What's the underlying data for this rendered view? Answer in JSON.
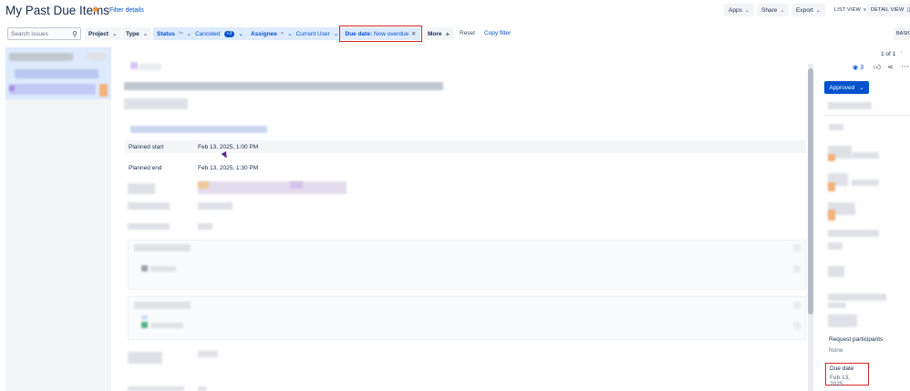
{
  "header": {
    "title": "My Past Due Items",
    "filter_details": "Filter details",
    "apps": "Apps",
    "share": "Share",
    "export": "Export",
    "list_view": "LIST VIEW",
    "detail_view": "DETAIL VIEW",
    "basic": "BASIC"
  },
  "filters": {
    "search_placeholder": "Search issues",
    "project": "Project",
    "type": "Type",
    "status": "Status",
    "status_op": "!=",
    "status_value": "Canceled",
    "status_count": "+3",
    "assignee": "Assignee",
    "assignee_op": "=",
    "assignee_value": "Current User",
    "due_date_key": "Due date:",
    "due_date_value": "Now overdue",
    "more": "More",
    "reset": "Reset",
    "copy_filter": "Copy filter"
  },
  "pagination": {
    "text": "1 of 1"
  },
  "detail": {
    "planned_start_label": "Planned start",
    "planned_start_value": "Feb 13, 2025, 1:00 PM",
    "planned_end_label": "Planned end",
    "planned_end_value": "Feb 13, 2025, 1:30 PM"
  },
  "right_panel": {
    "watchers": "3",
    "status_button": "Approved",
    "request_participants_label": "Request participants",
    "request_participants_value": "None",
    "due_date_label": "Due date",
    "due_date_value": "Feb 13, 2025"
  },
  "colors": {
    "accent": "#0052cc",
    "highlight_border": "#d6282d",
    "star": "#ff991f"
  }
}
